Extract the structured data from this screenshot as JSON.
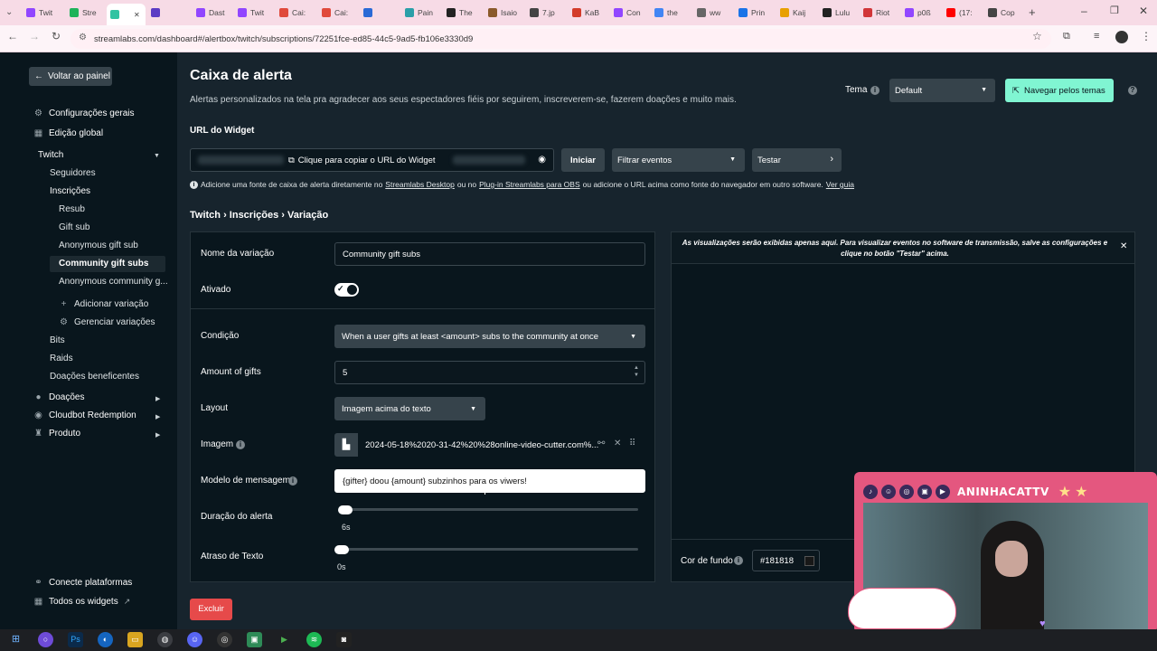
{
  "browser": {
    "tabs": [
      {
        "label": "Twit",
        "color": "#9146ff"
      },
      {
        "label": "Stre",
        "color": "#1eb35a"
      },
      {
        "label": "",
        "color": "#31c3a2",
        "active": true
      },
      {
        "label": "",
        "color": "#5b3cc4"
      },
      {
        "label": "Dast",
        "color": "#9146ff"
      },
      {
        "label": "Twit",
        "color": "#9146ff"
      },
      {
        "label": "Cai:",
        "color": "#e04a3c"
      },
      {
        "label": "Cai:",
        "color": "#e04a3c"
      },
      {
        "label": "",
        "color": "#2a6ad6"
      },
      {
        "label": "Pain",
        "color": "#2a9fa8"
      },
      {
        "label": "The",
        "color": "#222222"
      },
      {
        "label": "Isaio",
        "color": "#8a5a2b"
      },
      {
        "label": "7.jp",
        "color": "#444444"
      },
      {
        "label": "KaB",
        "color": "#d33b2a"
      },
      {
        "label": "Con",
        "color": "#9146ff"
      },
      {
        "label": "the",
        "color": "#4285f4"
      },
      {
        "label": "ww",
        "color": "#666666"
      },
      {
        "label": "Prin",
        "color": "#1a73e8"
      },
      {
        "label": "Kaij",
        "color": "#e8a000"
      },
      {
        "label": "Lulu",
        "color": "#222222"
      },
      {
        "label": "Riot",
        "color": "#d13639"
      },
      {
        "label": "p0ß",
        "color": "#9146ff"
      },
      {
        "label": "(17:",
        "color": "#ff0000"
      },
      {
        "label": "Cop",
        "color": "#444444"
      }
    ],
    "url": "streamlabs.com/dashboard#/alertbox/twitch/subscriptions/72251fce-ed85-44c5-9ad5-fb106e3330d9"
  },
  "sidebar": {
    "back_label": "Voltar ao painel",
    "config_label": "Configurações gerais",
    "global_label": "Edição global",
    "twitch_label": "Twitch",
    "followers_label": "Seguidores",
    "subs_label": "Inscrições",
    "resub_label": "Resub",
    "giftsub_label": "Gift sub",
    "anon_gift_label": "Anonymous gift sub",
    "community_label": "Community gift subs",
    "anon_community_label": "Anonymous community g...",
    "add_variation_label": "Adicionar variação",
    "manage_variations_label": "Gerenciar variações",
    "bits_label": "Bits",
    "raids_label": "Raids",
    "charity_label": "Doações beneficentes",
    "donations_label": "Doações",
    "cloudbot_label": "Cloudbot Redemption",
    "product_label": "Produto",
    "connect_label": "Conecte plataformas",
    "widgets_label": "Todos os widgets"
  },
  "header": {
    "title": "Caixa de alerta",
    "subtitle": "Alertas personalizados na tela pra agradecer aos seus espectadores fiéis por seguirem, inscreverem-se, fazerem doações e muito mais.",
    "theme_label": "Tema",
    "theme_value": "Default",
    "browse_themes_label": "Navegar pelos temas"
  },
  "widget": {
    "url_label": "URL do Widget",
    "copy_label": "Clique para copiar o URL do Widget",
    "start_label": "Iniciar",
    "filter_label": "Filtrar eventos",
    "test_label": "Testar",
    "info_part1": "Adicione uma fonte de caixa de alerta diretamente no",
    "info_link1": "Streamlabs Desktop",
    "info_part2": "ou no",
    "info_link2": "Plug-in Streamlabs para OBS",
    "info_part3": "ou adicione o URL acima como fonte do navegador em outro software.",
    "info_link3": "Ver guia"
  },
  "breadcrumb": "Twitch › Inscrições › Variação",
  "form": {
    "variation_name_label": "Nome da variação",
    "variation_name_value": "Community gift subs",
    "enabled_label": "Ativado",
    "condition_label": "Condição",
    "condition_value": "When a user gifts at least <amount> subs to the community at once",
    "amount_label": "Amount of gifts",
    "amount_value": "5",
    "layout_label": "Layout",
    "layout_value": "Imagem acima do texto",
    "image_label": "Imagem",
    "image_value": "2024-05-18%2020-31-42%20%28online-video-cutter.com%...",
    "message_label": "Modelo de mensagem",
    "message_value": "{gifter} doou {amount} subzinhos para os viwers!",
    "duration_label": "Duração do alerta",
    "duration_value": "6s",
    "delay_label": "Atraso de Texto",
    "delay_value": "0s",
    "delete_label": "Excluir"
  },
  "preview": {
    "notice": "As visualizações serão exibidas apenas aqui. Para visualizar eventos no software de transmissão, salve as configurações e clique no botão \"Testar\" acima.",
    "bg_label": "Cor de fundo",
    "bg_value": "#181818"
  },
  "overlay": {
    "channel_name": "ANINHACATTV"
  },
  "colors": {
    "accent": "#80f5d2",
    "danger": "#e64a4a",
    "overlay_border": "#e4577f"
  }
}
